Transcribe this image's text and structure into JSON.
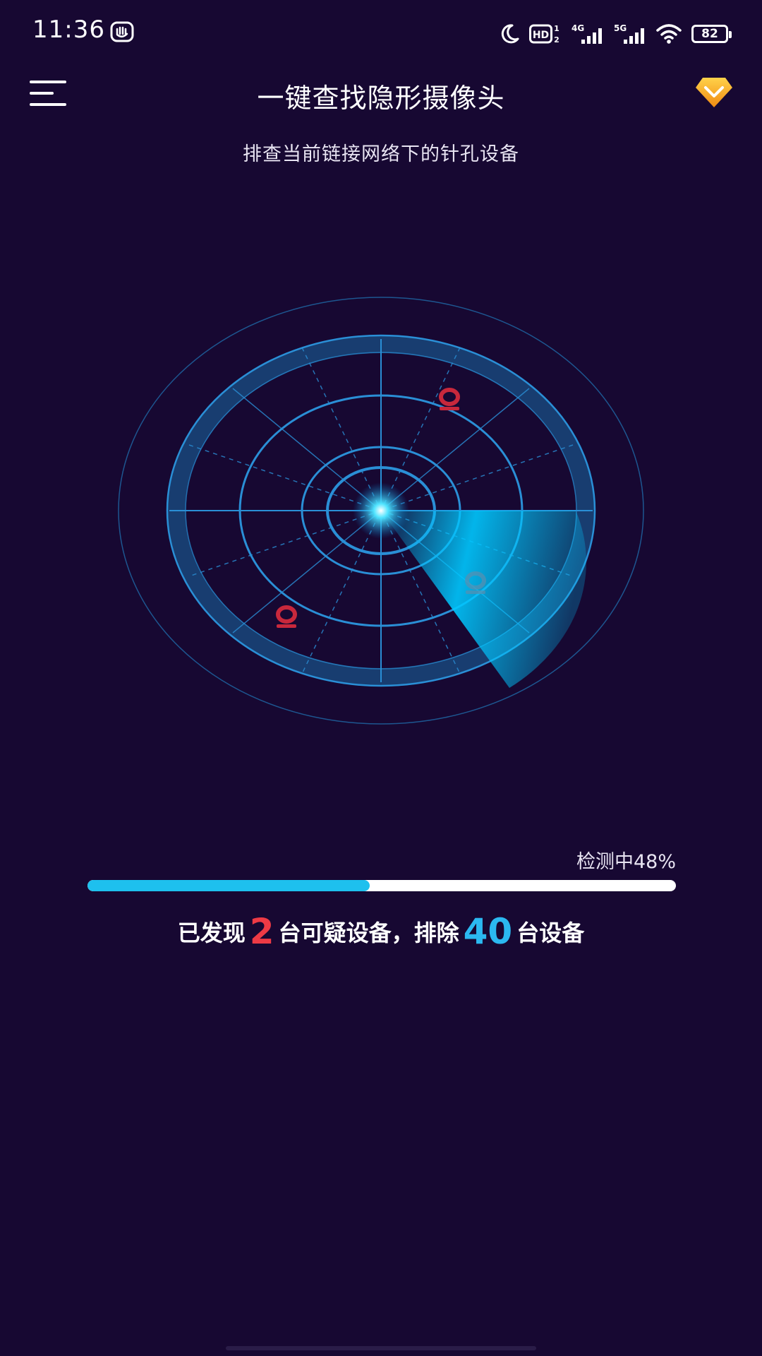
{
  "status_bar": {
    "time": "11:36",
    "battery": "82",
    "icons": [
      "hand-icon",
      "moon-icon",
      "hd-icon",
      "signal-4g-icon",
      "signal-5g-icon",
      "wifi-icon",
      "battery-icon"
    ],
    "hd_label": "HD",
    "hd_sub": "1",
    "hd_sub2": "2",
    "net1": "4G",
    "net2": "5G"
  },
  "header": {
    "title": "一键查找隐形摄像头",
    "subtitle": "排查当前链接网络下的针孔设备",
    "menu_icon": "menu-icon",
    "vip_icon": "vip-diamond-icon"
  },
  "radar": {
    "markers": [
      {
        "icon": "location-pin-icon",
        "color": "#c8283c"
      },
      {
        "icon": "location-pin-icon",
        "color": "#c8283c"
      },
      {
        "icon": "location-pin-icon",
        "color": "#5a8fb0"
      }
    ],
    "colors": {
      "ring": "#1f7bbf",
      "sweep": "#00c8ff",
      "center": "#4fe4ff"
    }
  },
  "scan": {
    "status_label": "检测中48%",
    "progress": 0.48,
    "progress_color": "#1ec0ee"
  },
  "result": {
    "prefix": "已发现",
    "found_count": "2",
    "middle": "台可疑设备，排除",
    "excluded_count": "40",
    "suffix": "台设备",
    "found_color": "#ee3a45",
    "excluded_color": "#2bb8f0"
  }
}
